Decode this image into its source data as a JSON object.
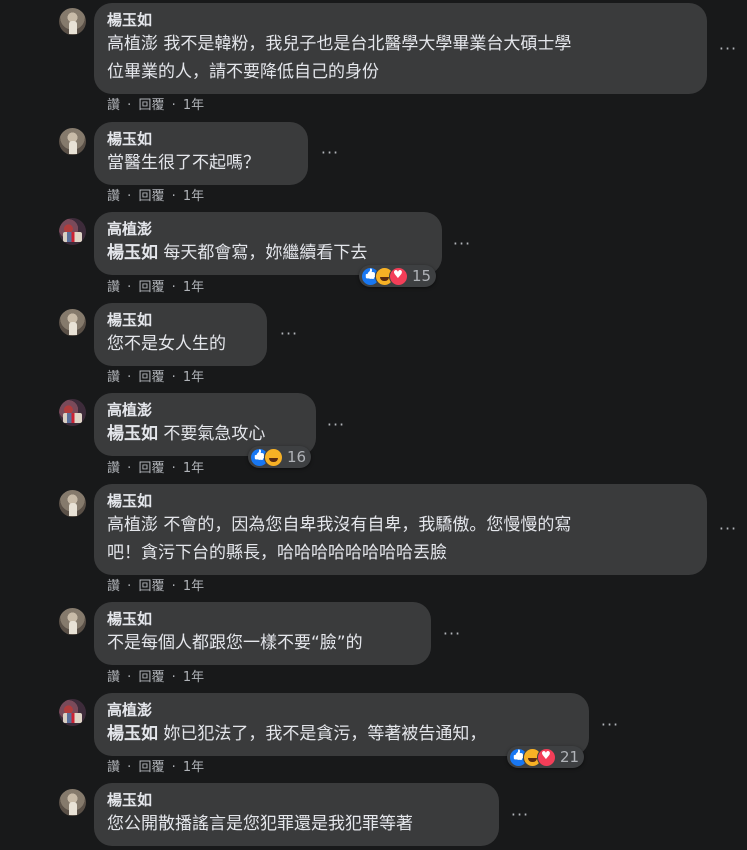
{
  "action_labels": {
    "like": "讚",
    "reply": "回覆",
    "sep": "·"
  },
  "comments": [
    {
      "author": "楊玉如",
      "mention": "",
      "text_lines": [
        "高植澎 我不是韓粉，我兒子也是台北醫學大學畢業台大碩士學",
        "位畢業的人，請不要降低自己的身份"
      ],
      "time": "1年"
    },
    {
      "author": "楊玉如",
      "mention": "",
      "text_lines": [
        "當醫生很了不起嗎？"
      ],
      "time": "1年"
    },
    {
      "author": "高植澎",
      "mention": "楊玉如",
      "text_lines": [
        "每天都會寫，妳繼續看下去"
      ],
      "time": "1年",
      "reactions": {
        "icons": [
          "like-icon",
          "haha-icon",
          "love-icon"
        ],
        "count": "15"
      }
    },
    {
      "author": "楊玉如",
      "mention": "",
      "text_lines": [
        "您不是女人生的"
      ],
      "time": "1年"
    },
    {
      "author": "高植澎",
      "mention": "楊玉如",
      "text_lines": [
        "不要氣急攻心"
      ],
      "time": "1年",
      "reactions": {
        "icons": [
          "like-icon",
          "haha-icon"
        ],
        "count": "16"
      }
    },
    {
      "author": "楊玉如",
      "mention": "",
      "text_lines": [
        "高植澎 不會的，因為您自卑我沒有自卑，我驕傲。您慢慢的寫",
        "吧！貪污下台的縣長，哈哈哈哈哈哈哈哈丟臉"
      ],
      "time": "1年"
    },
    {
      "author": "楊玉如",
      "mention": "",
      "text_lines": [
        "不是每個人都跟您一樣不要“臉”的"
      ],
      "time": "1年"
    },
    {
      "author": "高植澎",
      "mention": "楊玉如",
      "text_lines": [
        "妳已犯法了，我不是貪污，等著被告通知，"
      ],
      "time": "1年",
      "reactions": {
        "icons": [
          "like-icon",
          "haha-icon",
          "love-icon"
        ],
        "count": "21"
      }
    },
    {
      "author": "楊玉如",
      "mention": "",
      "text_lines": [
        "您公開散播謠言是您犯罪還是我犯罪等著"
      ],
      "time": ""
    }
  ]
}
